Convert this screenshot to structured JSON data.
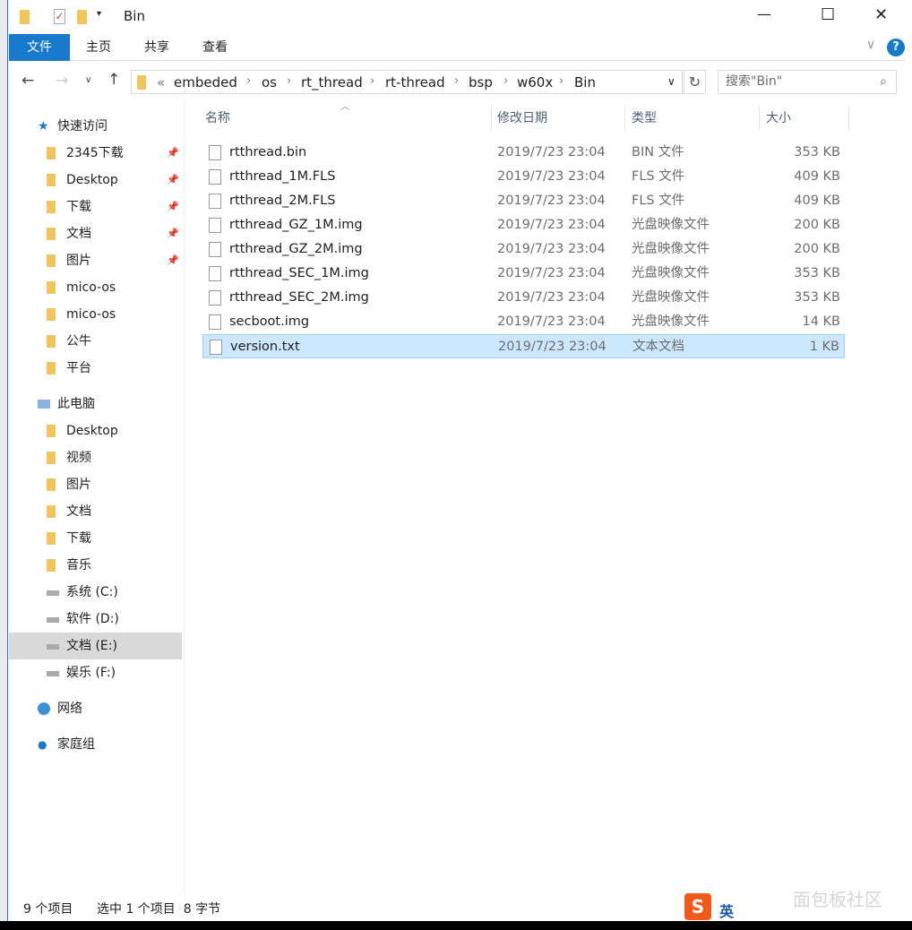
{
  "title": "Bin",
  "window_controls": {
    "minimize": "—",
    "maximize": "☐",
    "close": "✕"
  },
  "ribbon": {
    "tabs": [
      "文件",
      "主页",
      "共享",
      "查看"
    ],
    "help": "?"
  },
  "address": {
    "prefix": "«",
    "crumbs": [
      "embeded",
      "os",
      "rt_thread",
      "rt-thread",
      "bsp",
      "w60x",
      "Bin"
    ]
  },
  "search": {
    "placeholder": "搜索\"Bin\""
  },
  "sidebar": {
    "quick": {
      "label": "快速访问",
      "items": [
        {
          "label": "2345下载",
          "pinned": true
        },
        {
          "label": "Desktop",
          "pinned": true
        },
        {
          "label": "下载",
          "pinned": true
        },
        {
          "label": "文档",
          "pinned": true
        },
        {
          "label": "图片",
          "pinned": true
        },
        {
          "label": "mico-os"
        },
        {
          "label": "mico-os"
        },
        {
          "label": "公牛"
        },
        {
          "label": "平台"
        }
      ]
    },
    "pc": {
      "label": "此电脑",
      "items": [
        {
          "label": "Desktop"
        },
        {
          "label": "视频"
        },
        {
          "label": "图片"
        },
        {
          "label": "文档"
        },
        {
          "label": "下载"
        },
        {
          "label": "音乐"
        },
        {
          "label": "系统 (C:)"
        },
        {
          "label": "软件 (D:)"
        },
        {
          "label": "文档 (E:)",
          "selected": true
        },
        {
          "label": "娱乐 (F:)"
        }
      ]
    },
    "network": "网络",
    "homegroup": "家庭组"
  },
  "columns": [
    "名称",
    "修改日期",
    "类型",
    "大小"
  ],
  "files": [
    {
      "name": "rtthread.bin",
      "date": "2019/7/23 23:04",
      "type": "BIN 文件",
      "size": "353 KB"
    },
    {
      "name": "rtthread_1M.FLS",
      "date": "2019/7/23 23:04",
      "type": "FLS 文件",
      "size": "409 KB"
    },
    {
      "name": "rtthread_2M.FLS",
      "date": "2019/7/23 23:04",
      "type": "FLS 文件",
      "size": "409 KB"
    },
    {
      "name": "rtthread_GZ_1M.img",
      "date": "2019/7/23 23:04",
      "type": "光盘映像文件",
      "size": "200 KB"
    },
    {
      "name": "rtthread_GZ_2M.img",
      "date": "2019/7/23 23:04",
      "type": "光盘映像文件",
      "size": "200 KB"
    },
    {
      "name": "rtthread_SEC_1M.img",
      "date": "2019/7/23 23:04",
      "type": "光盘映像文件",
      "size": "353 KB"
    },
    {
      "name": "rtthread_SEC_2M.img",
      "date": "2019/7/23 23:04",
      "type": "光盘映像文件",
      "size": "353 KB"
    },
    {
      "name": "secboot.img",
      "date": "2019/7/23 23:04",
      "type": "光盘映像文件",
      "size": "14 KB"
    },
    {
      "name": "version.txt",
      "date": "2019/7/23 23:04",
      "type": "文本文档",
      "size": "1 KB",
      "selected": true
    }
  ],
  "status": {
    "count": "9 个项目",
    "selection": "选中 1 个项目  8 字节"
  },
  "ime": {
    "label": "英"
  },
  "watermark": "面包板社区",
  "colors": {
    "accent": "#1979ca",
    "selection": "#cce8ff"
  }
}
